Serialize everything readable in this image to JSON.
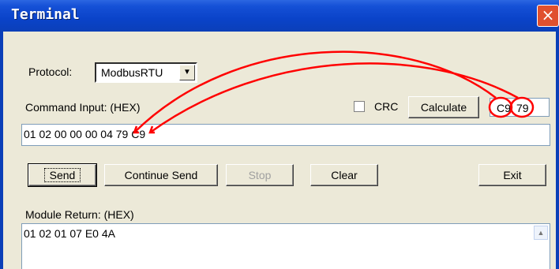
{
  "window": {
    "title": "Terminal",
    "close_icon": "×"
  },
  "protocol": {
    "label": "Protocol:",
    "value": "ModbusRTU",
    "arrow": "▼"
  },
  "command": {
    "label": "Command Input:  (HEX)",
    "crc_label": "CRC",
    "calculate_label": "Calculate",
    "crc_byte1": "C9",
    "crc_byte2": "79",
    "input_value": "01 02 00 00 00 04 79 C9"
  },
  "actions": {
    "send": "Send",
    "continue_send": "Continue Send",
    "stop": "Stop",
    "clear": "Clear",
    "exit": "Exit"
  },
  "module_return": {
    "label": "Module Return:   (HEX)",
    "value": "01 02 01 07 E0 4A",
    "scroll_up": "▲"
  },
  "colors": {
    "titlebar": "#0a43c9",
    "annotation": "#ff0000",
    "dialog_bg": "#ece9d8"
  }
}
